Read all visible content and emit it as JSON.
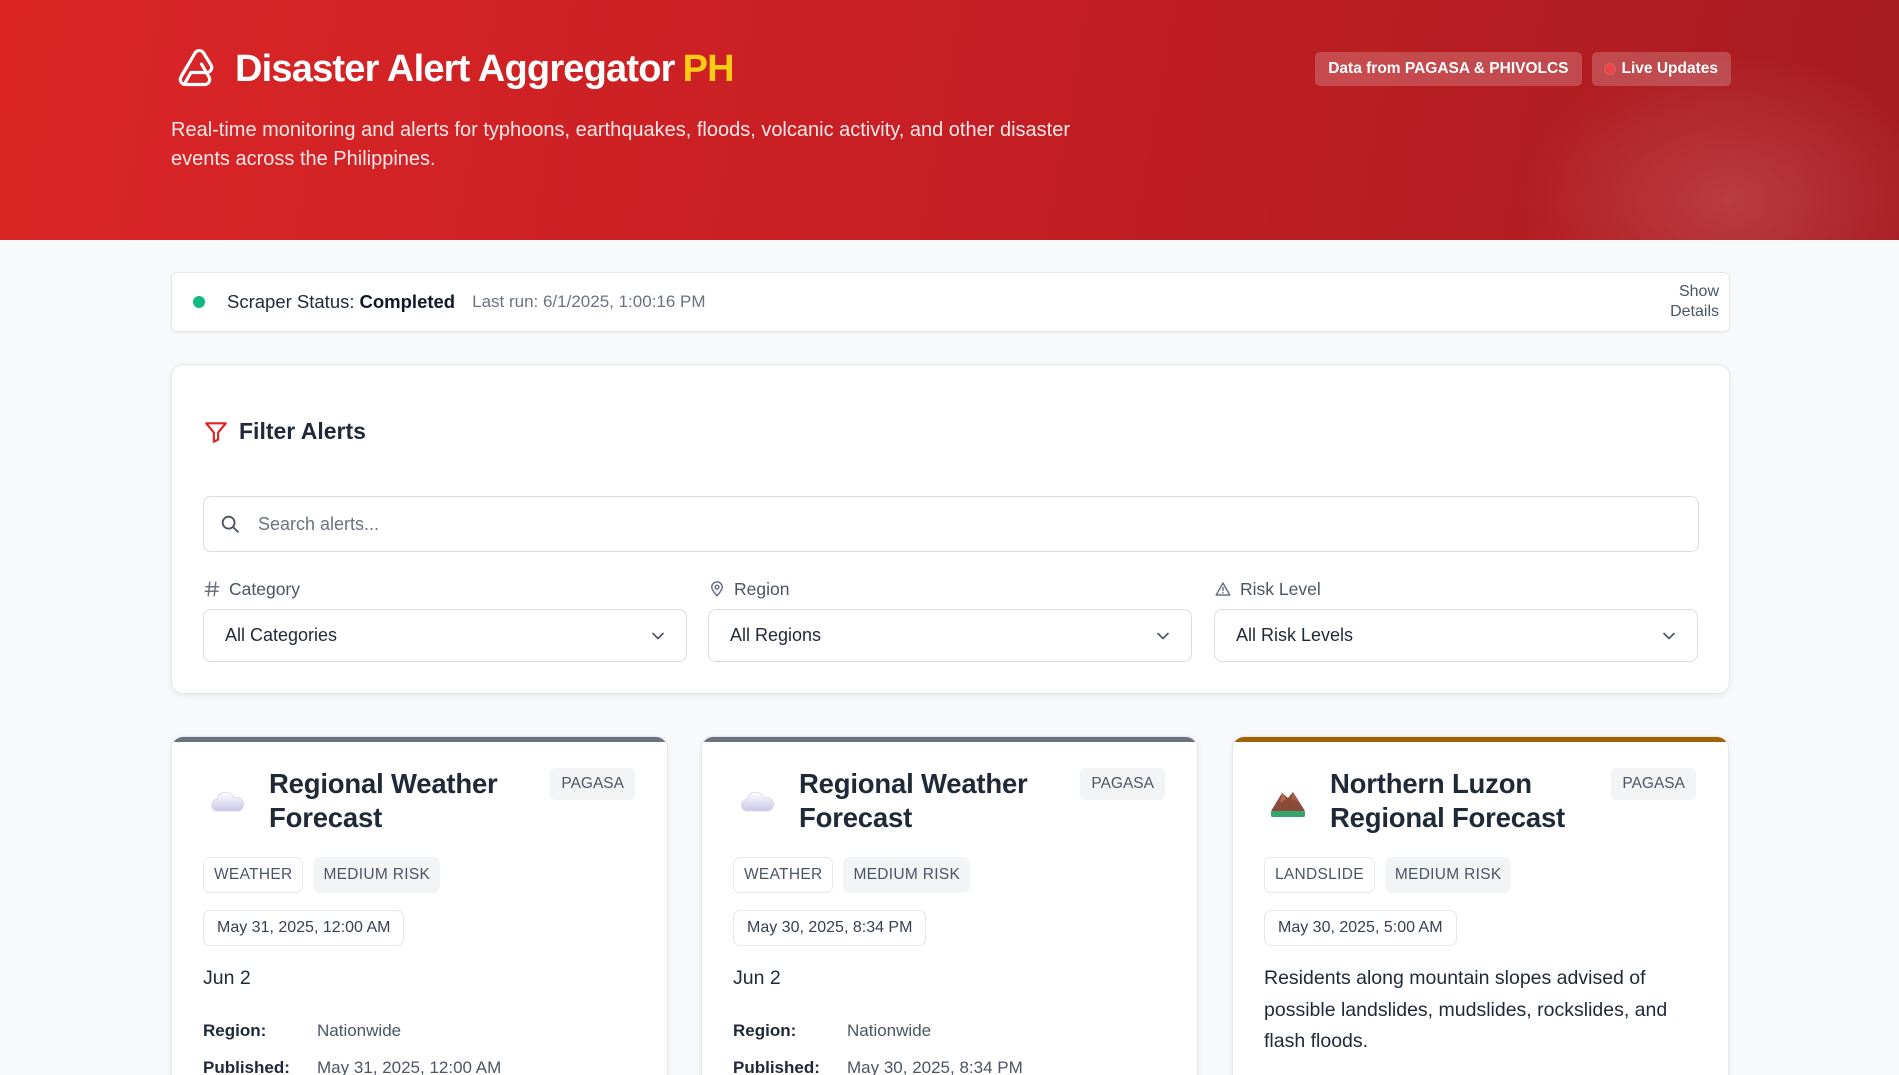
{
  "header": {
    "title": "Disaster Alert Aggregator",
    "title_suffix": "PH",
    "description": "Real-time monitoring and alerts for typhoons, earthquakes, floods, volcanic activity, and other disaster events across the Philippines.",
    "badges": {
      "source": "Data from PAGASA & PHIVOLCS",
      "live": "Live Updates"
    }
  },
  "status": {
    "label": "Scraper Status:",
    "value": "Completed",
    "last_run": "Last run: 6/1/2025, 1:00:16 PM",
    "details_label": "Show Details"
  },
  "filters": {
    "title": "Filter Alerts",
    "search_placeholder": "Search alerts...",
    "category": {
      "label": "Category",
      "value": "All Categories"
    },
    "region": {
      "label": "Region",
      "value": "All Regions"
    },
    "risk": {
      "label": "Risk Level",
      "value": "All Risk Levels"
    }
  },
  "colors": {
    "header_red": "#dc2626",
    "brand_yellow": "#facc15",
    "status_green": "#10b981",
    "live_red": "#ef4444",
    "card_bar_gray": "#6b7280",
    "card_bar_brown": "#a16207"
  },
  "cards": [
    {
      "icon": "cloud-icon",
      "title": "Regional Weather Forecast",
      "source": "PAGASA",
      "category": "WEATHER",
      "risk": "MEDIUM RISK",
      "date": "May 31, 2025, 12:00 AM",
      "description": "Jun 2",
      "region_label": "Region:",
      "region": "Nationwide",
      "published_label": "Published:",
      "published": "May 31, 2025, 12:00 AM"
    },
    {
      "icon": "cloud-icon",
      "title": "Regional Weather Forecast",
      "source": "PAGASA",
      "category": "WEATHER",
      "risk": "MEDIUM RISK",
      "date": "May 30, 2025, 8:34 PM",
      "description": "Jun 2",
      "region_label": "Region:",
      "region": "Nationwide",
      "published_label": "Published:",
      "published": "May 30, 2025, 8:34 PM"
    },
    {
      "icon": "landslide-icon",
      "title": "Northern Luzon Regional Forecast",
      "source": "PAGASA",
      "category": "LANDSLIDE",
      "risk": "MEDIUM RISK",
      "date": "May 30, 2025, 5:00 AM",
      "description": "Residents along mountain slopes advised of possible landslides, mudslides, rockslides, and flash floods."
    }
  ]
}
